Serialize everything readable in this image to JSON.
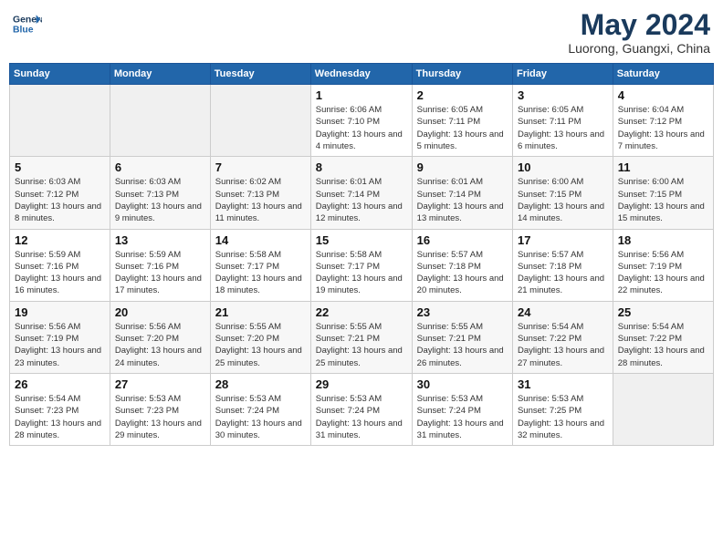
{
  "header": {
    "logo_line1": "General",
    "logo_line2": "Blue",
    "month": "May 2024",
    "location": "Luorong, Guangxi, China"
  },
  "weekdays": [
    "Sunday",
    "Monday",
    "Tuesday",
    "Wednesday",
    "Thursday",
    "Friday",
    "Saturday"
  ],
  "weeks": [
    [
      {
        "day": "",
        "info": ""
      },
      {
        "day": "",
        "info": ""
      },
      {
        "day": "",
        "info": ""
      },
      {
        "day": "1",
        "info": "Sunrise: 6:06 AM\nSunset: 7:10 PM\nDaylight: 13 hours and 4 minutes."
      },
      {
        "day": "2",
        "info": "Sunrise: 6:05 AM\nSunset: 7:11 PM\nDaylight: 13 hours and 5 minutes."
      },
      {
        "day": "3",
        "info": "Sunrise: 6:05 AM\nSunset: 7:11 PM\nDaylight: 13 hours and 6 minutes."
      },
      {
        "day": "4",
        "info": "Sunrise: 6:04 AM\nSunset: 7:12 PM\nDaylight: 13 hours and 7 minutes."
      }
    ],
    [
      {
        "day": "5",
        "info": "Sunrise: 6:03 AM\nSunset: 7:12 PM\nDaylight: 13 hours and 8 minutes."
      },
      {
        "day": "6",
        "info": "Sunrise: 6:03 AM\nSunset: 7:13 PM\nDaylight: 13 hours and 9 minutes."
      },
      {
        "day": "7",
        "info": "Sunrise: 6:02 AM\nSunset: 7:13 PM\nDaylight: 13 hours and 11 minutes."
      },
      {
        "day": "8",
        "info": "Sunrise: 6:01 AM\nSunset: 7:14 PM\nDaylight: 13 hours and 12 minutes."
      },
      {
        "day": "9",
        "info": "Sunrise: 6:01 AM\nSunset: 7:14 PM\nDaylight: 13 hours and 13 minutes."
      },
      {
        "day": "10",
        "info": "Sunrise: 6:00 AM\nSunset: 7:15 PM\nDaylight: 13 hours and 14 minutes."
      },
      {
        "day": "11",
        "info": "Sunrise: 6:00 AM\nSunset: 7:15 PM\nDaylight: 13 hours and 15 minutes."
      }
    ],
    [
      {
        "day": "12",
        "info": "Sunrise: 5:59 AM\nSunset: 7:16 PM\nDaylight: 13 hours and 16 minutes."
      },
      {
        "day": "13",
        "info": "Sunrise: 5:59 AM\nSunset: 7:16 PM\nDaylight: 13 hours and 17 minutes."
      },
      {
        "day": "14",
        "info": "Sunrise: 5:58 AM\nSunset: 7:17 PM\nDaylight: 13 hours and 18 minutes."
      },
      {
        "day": "15",
        "info": "Sunrise: 5:58 AM\nSunset: 7:17 PM\nDaylight: 13 hours and 19 minutes."
      },
      {
        "day": "16",
        "info": "Sunrise: 5:57 AM\nSunset: 7:18 PM\nDaylight: 13 hours and 20 minutes."
      },
      {
        "day": "17",
        "info": "Sunrise: 5:57 AM\nSunset: 7:18 PM\nDaylight: 13 hours and 21 minutes."
      },
      {
        "day": "18",
        "info": "Sunrise: 5:56 AM\nSunset: 7:19 PM\nDaylight: 13 hours and 22 minutes."
      }
    ],
    [
      {
        "day": "19",
        "info": "Sunrise: 5:56 AM\nSunset: 7:19 PM\nDaylight: 13 hours and 23 minutes."
      },
      {
        "day": "20",
        "info": "Sunrise: 5:56 AM\nSunset: 7:20 PM\nDaylight: 13 hours and 24 minutes."
      },
      {
        "day": "21",
        "info": "Sunrise: 5:55 AM\nSunset: 7:20 PM\nDaylight: 13 hours and 25 minutes."
      },
      {
        "day": "22",
        "info": "Sunrise: 5:55 AM\nSunset: 7:21 PM\nDaylight: 13 hours and 25 minutes."
      },
      {
        "day": "23",
        "info": "Sunrise: 5:55 AM\nSunset: 7:21 PM\nDaylight: 13 hours and 26 minutes."
      },
      {
        "day": "24",
        "info": "Sunrise: 5:54 AM\nSunset: 7:22 PM\nDaylight: 13 hours and 27 minutes."
      },
      {
        "day": "25",
        "info": "Sunrise: 5:54 AM\nSunset: 7:22 PM\nDaylight: 13 hours and 28 minutes."
      }
    ],
    [
      {
        "day": "26",
        "info": "Sunrise: 5:54 AM\nSunset: 7:23 PM\nDaylight: 13 hours and 28 minutes."
      },
      {
        "day": "27",
        "info": "Sunrise: 5:53 AM\nSunset: 7:23 PM\nDaylight: 13 hours and 29 minutes."
      },
      {
        "day": "28",
        "info": "Sunrise: 5:53 AM\nSunset: 7:24 PM\nDaylight: 13 hours and 30 minutes."
      },
      {
        "day": "29",
        "info": "Sunrise: 5:53 AM\nSunset: 7:24 PM\nDaylight: 13 hours and 31 minutes."
      },
      {
        "day": "30",
        "info": "Sunrise: 5:53 AM\nSunset: 7:24 PM\nDaylight: 13 hours and 31 minutes."
      },
      {
        "day": "31",
        "info": "Sunrise: 5:53 AM\nSunset: 7:25 PM\nDaylight: 13 hours and 32 minutes."
      },
      {
        "day": "",
        "info": ""
      }
    ]
  ]
}
